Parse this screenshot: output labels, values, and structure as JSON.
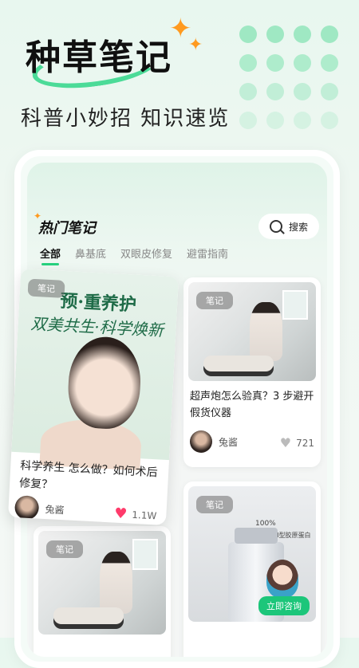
{
  "hero": {
    "title": "种草笔记",
    "subtitle": "科普小妙招  知识速览"
  },
  "section": {
    "title": "热门笔记",
    "search_label": "搜索"
  },
  "tabs": [
    "全部",
    "鼻基底",
    "双眼皮修复",
    "避雷指南"
  ],
  "cards": [
    {
      "tag": "笔记",
      "image_headline": "预·重养护",
      "image_sub": "双美共生·科学焕新",
      "title": "科学养生 怎么做？如何术后修复？",
      "author": "兔酱",
      "likes": "1.1W"
    },
    {
      "tag": "笔记",
      "title": "超声炮怎么验真？3 步避开假货仪器",
      "author": "兔酱",
      "likes": "721"
    },
    {
      "tag": "笔记"
    },
    {
      "tag": "笔记",
      "image_text_1": "100%",
      "image_text_2": "人源化Ⅲ型胶原蛋白",
      "cta": "立即咨询"
    }
  ],
  "colors": {
    "accent": "#27d17f",
    "heart_active": "#ff3b6b",
    "sparkle": "#ff9a1f"
  }
}
